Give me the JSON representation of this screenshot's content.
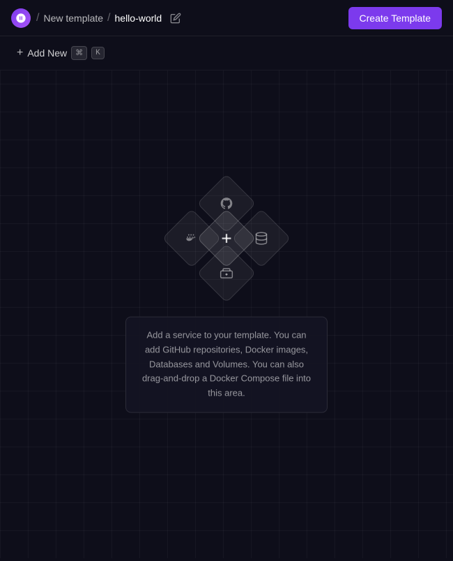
{
  "header": {
    "logo_alt": "Railway logo",
    "breadcrumb": [
      {
        "label": "New template",
        "active": false
      },
      {
        "label": "hello-world",
        "active": true
      }
    ],
    "edit_button_label": "Edit",
    "create_button_label": "Create Template"
  },
  "toolbar": {
    "add_new_label": "Add New",
    "kbd_meta": "⌘",
    "kbd_key": "K"
  },
  "canvas": {
    "hint_text": "Add a service to your template. You can add GitHub repositories, Docker images, Databases and Volumes. You can also drag-and-drop a Docker Compose file into this area.",
    "icons": {
      "github": "github-icon",
      "docker": "docker-icon",
      "database": "database-icon",
      "volume": "volume-icon",
      "plus": "plus-icon"
    }
  }
}
